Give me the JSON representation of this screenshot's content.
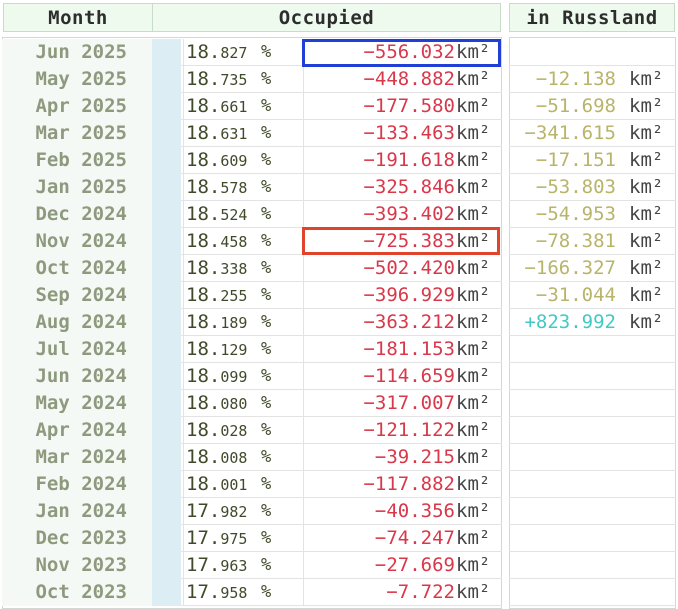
{
  "header": {
    "month": "Month",
    "occupied": "Occupied",
    "russland": "in Russland"
  },
  "rows": [
    {
      "month": "Jun 2025",
      "pct_a": "18.",
      "pct_b": "827",
      "pct_unit": "%",
      "delta": "−556.032",
      "delta_unit": "km²",
      "rus": "",
      "rus_unit": ""
    },
    {
      "month": "May 2025",
      "pct_a": "18.",
      "pct_b": "735",
      "pct_unit": "%",
      "delta": "−448.882",
      "delta_unit": "km²",
      "rus": "−12.138",
      "rus_unit": "km²"
    },
    {
      "month": "Apr 2025",
      "pct_a": "18.",
      "pct_b": "661",
      "pct_unit": "%",
      "delta": "−177.580",
      "delta_unit": "km²",
      "rus": "−51.698",
      "rus_unit": "km²"
    },
    {
      "month": "Mar 2025",
      "pct_a": "18.",
      "pct_b": "631",
      "pct_unit": "%",
      "delta": "−133.463",
      "delta_unit": "km²",
      "rus": "−341.615",
      "rus_unit": "km²"
    },
    {
      "month": "Feb 2025",
      "pct_a": "18.",
      "pct_b": "609",
      "pct_unit": "%",
      "delta": "−191.618",
      "delta_unit": "km²",
      "rus": "−17.151",
      "rus_unit": "km²"
    },
    {
      "month": "Jan 2025",
      "pct_a": "18.",
      "pct_b": "578",
      "pct_unit": "%",
      "delta": "−325.846",
      "delta_unit": "km²",
      "rus": "−53.803",
      "rus_unit": "km²"
    },
    {
      "month": "Dec 2024",
      "pct_a": "18.",
      "pct_b": "524",
      "pct_unit": "%",
      "delta": "−393.402",
      "delta_unit": "km²",
      "rus": "−54.953",
      "rus_unit": "km²"
    },
    {
      "month": "Nov 2024",
      "pct_a": "18.",
      "pct_b": "458",
      "pct_unit": "%",
      "delta": "−725.383",
      "delta_unit": "km²",
      "rus": "−78.381",
      "rus_unit": "km²"
    },
    {
      "month": "Oct 2024",
      "pct_a": "18.",
      "pct_b": "338",
      "pct_unit": "%",
      "delta": "−502.420",
      "delta_unit": "km²",
      "rus": "−166.327",
      "rus_unit": "km²"
    },
    {
      "month": "Sep 2024",
      "pct_a": "18.",
      "pct_b": "255",
      "pct_unit": "%",
      "delta": "−396.929",
      "delta_unit": "km²",
      "rus": "−31.044",
      "rus_unit": "km²"
    },
    {
      "month": "Aug 2024",
      "pct_a": "18.",
      "pct_b": "189",
      "pct_unit": "%",
      "delta": "−363.212",
      "delta_unit": "km²",
      "rus": "+823.992",
      "rus_unit": "km²"
    },
    {
      "month": "Jul 2024",
      "pct_a": "18.",
      "pct_b": "129",
      "pct_unit": "%",
      "delta": "−181.153",
      "delta_unit": "km²",
      "rus": "",
      "rus_unit": ""
    },
    {
      "month": "Jun 2024",
      "pct_a": "18.",
      "pct_b": "099",
      "pct_unit": "%",
      "delta": "−114.659",
      "delta_unit": "km²",
      "rus": "",
      "rus_unit": ""
    },
    {
      "month": "May 2024",
      "pct_a": "18.",
      "pct_b": "080",
      "pct_unit": "%",
      "delta": "−317.007",
      "delta_unit": "km²",
      "rus": "",
      "rus_unit": ""
    },
    {
      "month": "Apr 2024",
      "pct_a": "18.",
      "pct_b": "028",
      "pct_unit": "%",
      "delta": "−121.122",
      "delta_unit": "km²",
      "rus": "",
      "rus_unit": ""
    },
    {
      "month": "Mar 2024",
      "pct_a": "18.",
      "pct_b": "008",
      "pct_unit": "%",
      "delta": "−39.215",
      "delta_unit": "km²",
      "rus": "",
      "rus_unit": ""
    },
    {
      "month": "Feb 2024",
      "pct_a": "18.",
      "pct_b": "001",
      "pct_unit": "%",
      "delta": "−117.882",
      "delta_unit": "km²",
      "rus": "",
      "rus_unit": ""
    },
    {
      "month": "Jan 2024",
      "pct_a": "17.",
      "pct_b": "982",
      "pct_unit": "%",
      "delta": "−40.356",
      "delta_unit": "km²",
      "rus": "",
      "rus_unit": ""
    },
    {
      "month": "Dec 2023",
      "pct_a": "17.",
      "pct_b": "975",
      "pct_unit": "%",
      "delta": "−74.247",
      "delta_unit": "km²",
      "rus": "",
      "rus_unit": ""
    },
    {
      "month": "Nov 2023",
      "pct_a": "17.",
      "pct_b": "963",
      "pct_unit": "%",
      "delta": "−27.669",
      "delta_unit": "km²",
      "rus": "",
      "rus_unit": ""
    },
    {
      "month": "Oct 2023",
      "pct_a": "17.",
      "pct_b": "958",
      "pct_unit": "%",
      "delta": "−7.722",
      "delta_unit": "km²",
      "rus": "",
      "rus_unit": ""
    }
  ],
  "colors": {
    "negative": "#d9384a",
    "russland_negative": "#b8b46a",
    "russland_positive": "#43c9c5",
    "highlight_blue": "#1f3fd6",
    "highlight_red": "#e0442c"
  }
}
